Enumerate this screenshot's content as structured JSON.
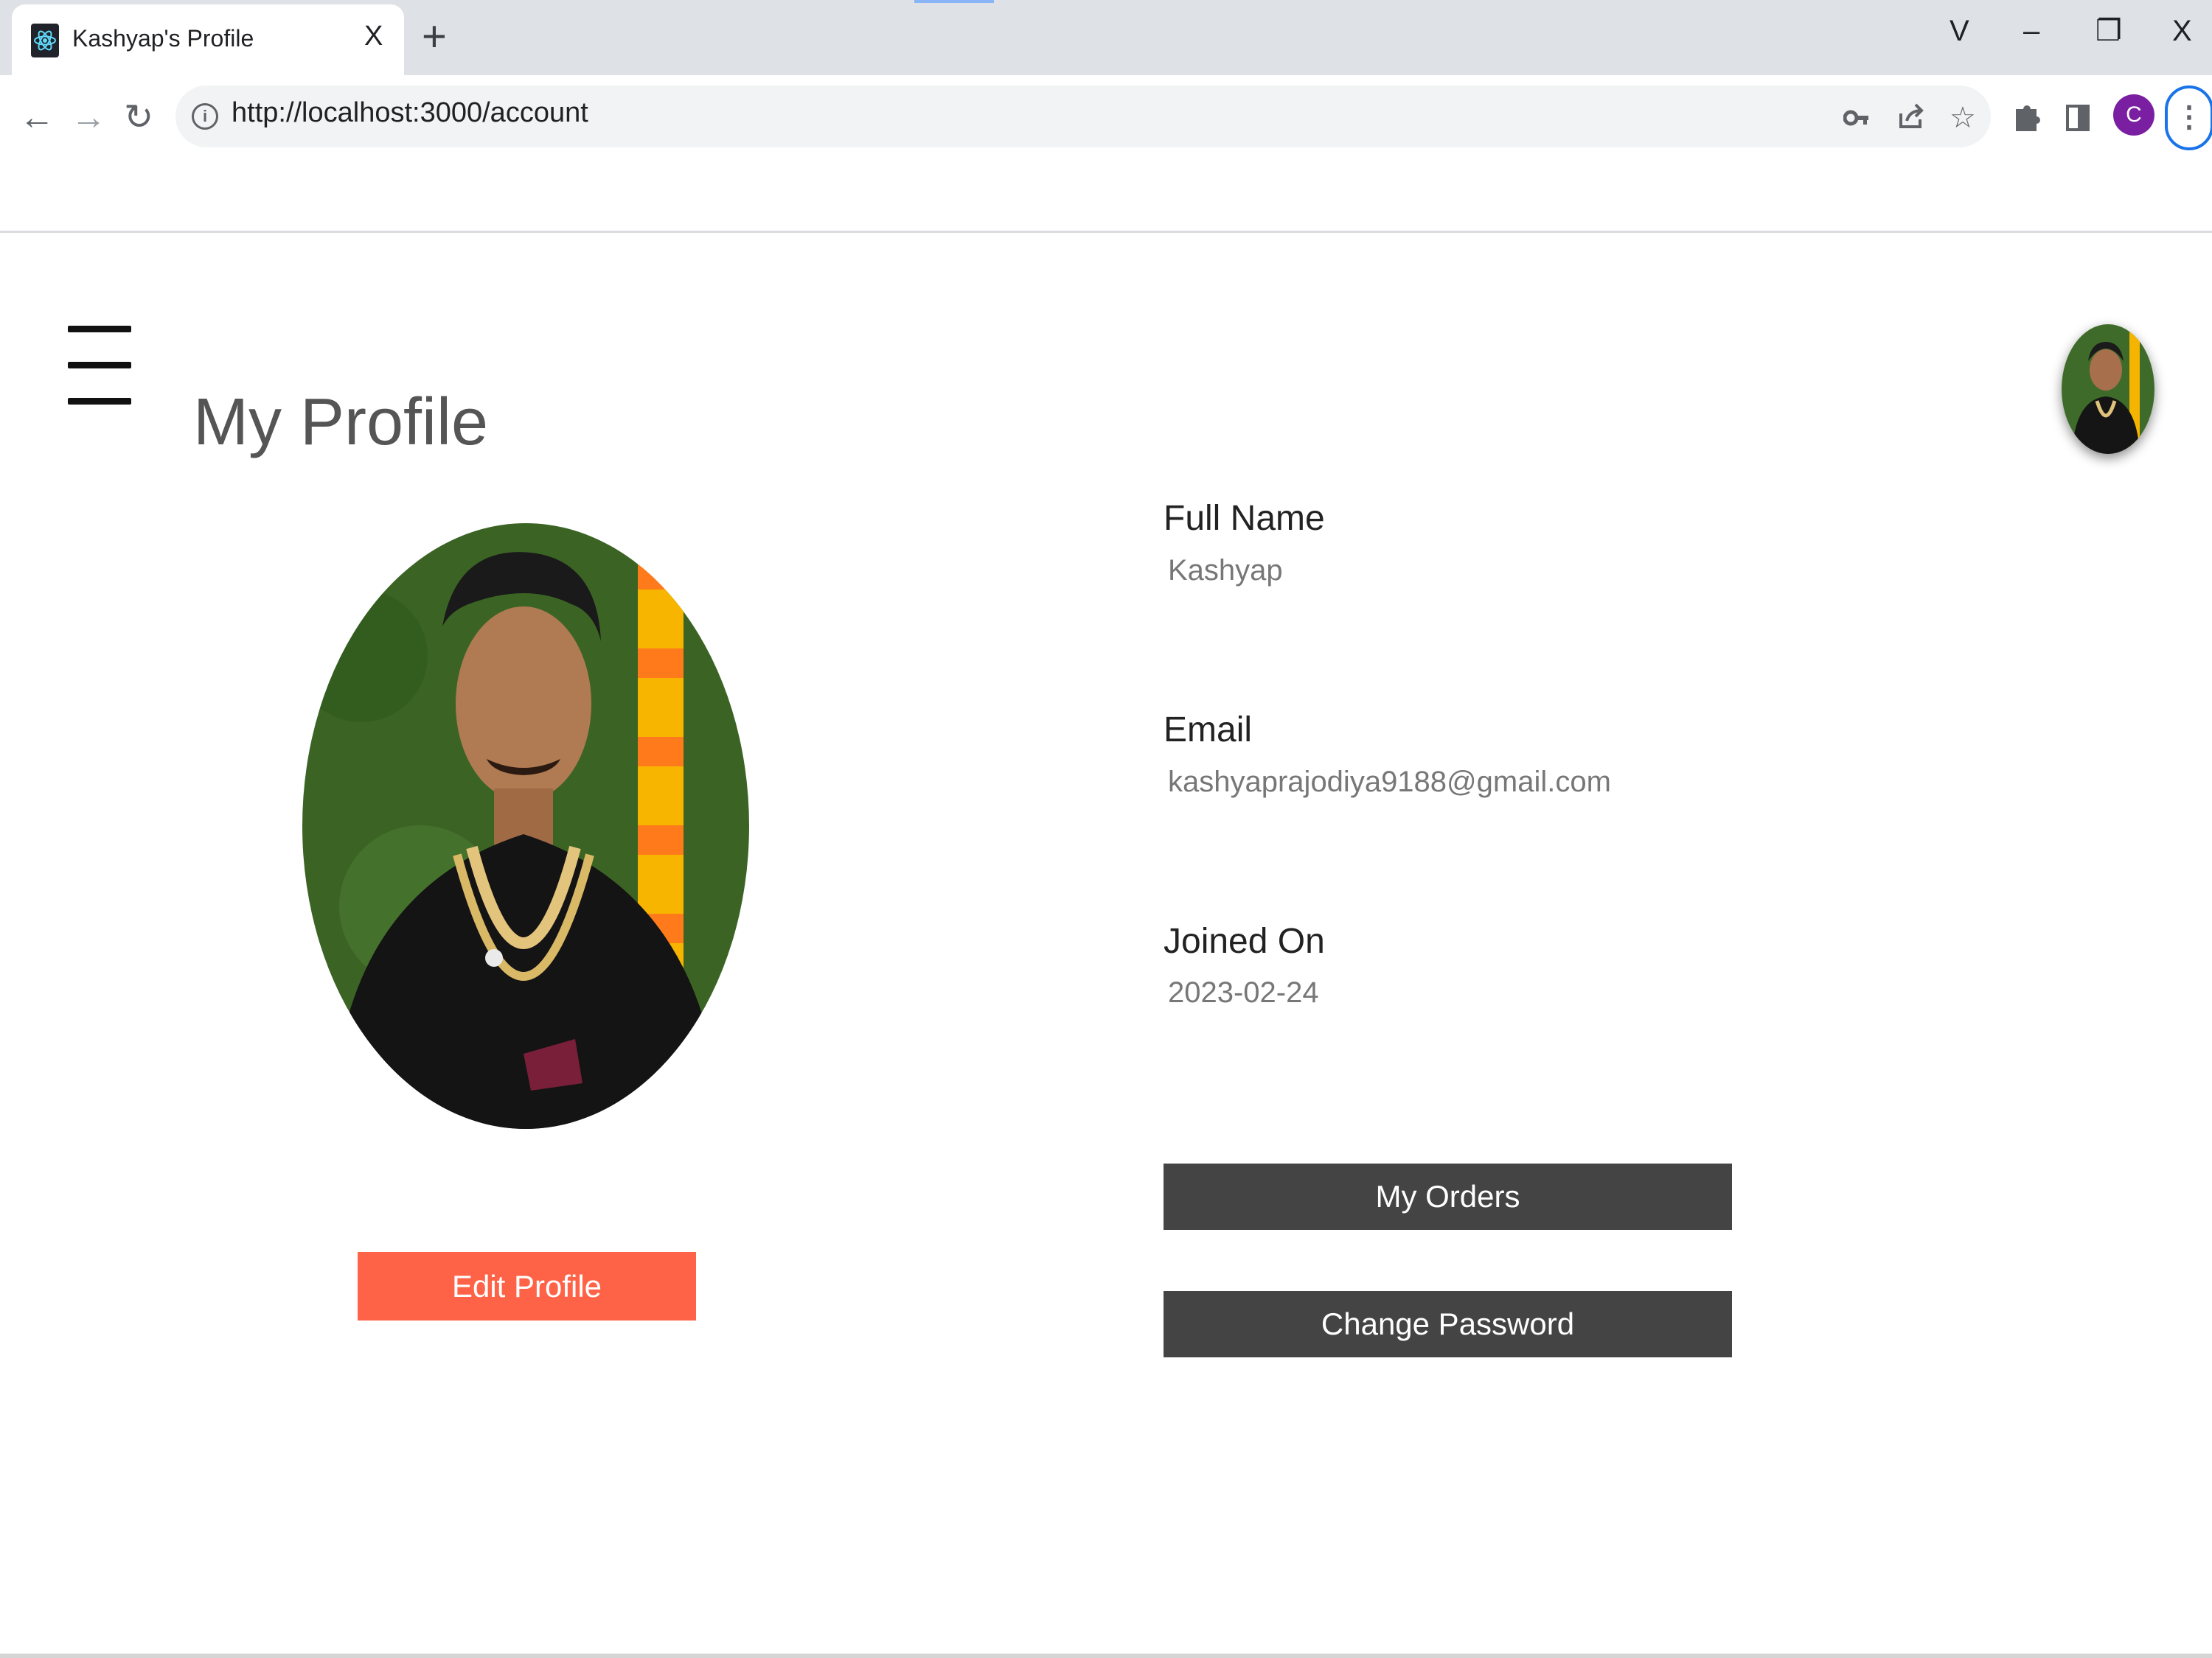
{
  "browser": {
    "tab_title": "Kashyap's Profile",
    "tab_close": "X",
    "new_tab": "+",
    "url": "http://localhost:3000/account",
    "profile_initial": "C",
    "window_controls": {
      "search_tabs": "V",
      "minimize": "–",
      "restore": "❐",
      "close": "X"
    }
  },
  "page": {
    "title": "My Profile",
    "fields": [
      {
        "label": "Full Name",
        "value": "Kashyap"
      },
      {
        "label": "Email",
        "value": "kashyaprajodiya9188@gmail.com"
      },
      {
        "label": "Joined On",
        "value": "2023-02-24"
      }
    ],
    "buttons": {
      "edit_profile": "Edit Profile",
      "my_orders": "My Orders",
      "change_password": "Change Password"
    }
  },
  "icons": {
    "back": "arrow-left-icon",
    "forward": "arrow-right-icon",
    "reload": "reload-icon",
    "menu": "hamburger-menu-icon",
    "password_key": "key-icon",
    "share": "share-icon",
    "bookmark": "star-icon",
    "extensions": "puzzle-icon",
    "side_panel": "side-panel-icon"
  },
  "colors": {
    "edit_button": "#ff6347",
    "dark_button": "#444444",
    "profile_chip": "#7b1fa2",
    "chrome_bg": "#dee1e6"
  }
}
